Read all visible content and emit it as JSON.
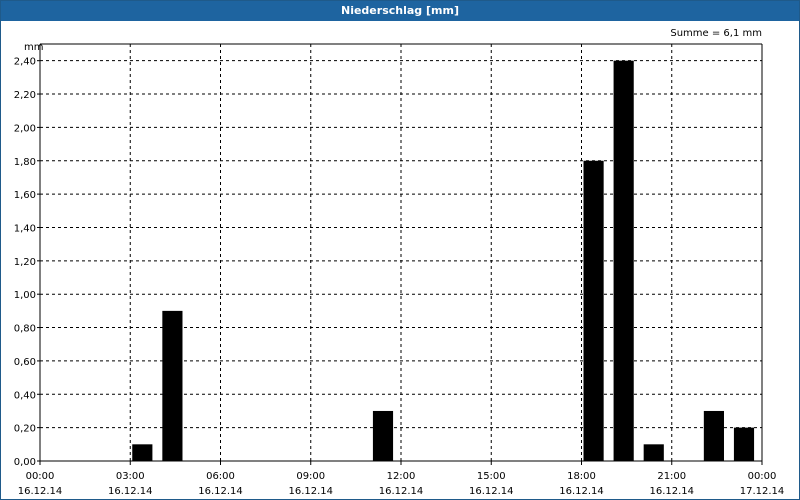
{
  "window": {
    "title": "Niederschlag [mm]"
  },
  "annotation": "Summe = 6,1 mm",
  "chart_data": {
    "type": "bar",
    "title": "Niederschlag [mm]",
    "ylabel": "mm",
    "xlabel": "",
    "ylim": [
      0,
      2.5
    ],
    "y_ticks": [
      "0,00",
      "0,20",
      "0,40",
      "0,60",
      "0,80",
      "1,00",
      "1,20",
      "1,40",
      "1,60",
      "1,80",
      "2,00",
      "2,20",
      "2,40"
    ],
    "x_ticks": [
      {
        "time": "00:00",
        "date": "16.12.14"
      },
      {
        "time": "03:00",
        "date": "16.12.14"
      },
      {
        "time": "06:00",
        "date": "16.12.14"
      },
      {
        "time": "09:00",
        "date": "16.12.14"
      },
      {
        "time": "12:00",
        "date": "16.12.14"
      },
      {
        "time": "15:00",
        "date": "16.12.14"
      },
      {
        "time": "18:00",
        "date": "16.12.14"
      },
      {
        "time": "21:00",
        "date": "16.12.14"
      },
      {
        "time": "00:00",
        "date": "17.12.14"
      }
    ],
    "bars": [
      {
        "time": "03:00",
        "value": 0.1
      },
      {
        "time": "04:00",
        "value": 0.9
      },
      {
        "time": "11:00",
        "value": 0.3
      },
      {
        "time": "18:00",
        "value": 1.8
      },
      {
        "time": "19:00",
        "value": 2.4
      },
      {
        "time": "20:00",
        "value": 0.1
      },
      {
        "time": "22:00",
        "value": 0.3
      },
      {
        "time": "23:00",
        "value": 0.2
      }
    ],
    "bar_color": "#000000",
    "grid": true
  }
}
